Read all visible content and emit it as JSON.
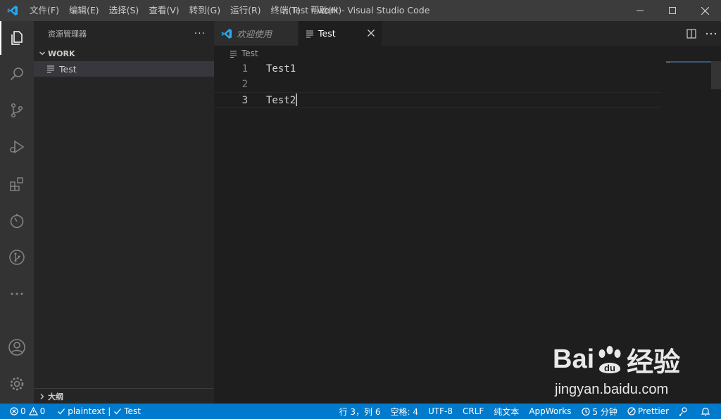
{
  "titlebar": {
    "menu": [
      "文件(F)",
      "编辑(E)",
      "选择(S)",
      "查看(V)",
      "转到(G)",
      "运行(R)",
      "终端(T)",
      "帮助(H)"
    ],
    "title": "Test - work - Visual Studio Code"
  },
  "sidebar": {
    "header": "资源管理器",
    "more": "···",
    "folder": "WORK",
    "file": "Test",
    "outline": "大纲"
  },
  "editor": {
    "tabs": [
      {
        "label": "欢迎使用",
        "active": false
      },
      {
        "label": "Test",
        "active": true
      }
    ],
    "breadcrumb": "Test",
    "lines": [
      {
        "num": "1",
        "text": "Test1"
      },
      {
        "num": "2",
        "text": ""
      },
      {
        "num": "3",
        "text": "Test2"
      }
    ]
  },
  "statusbar": {
    "errors": "0",
    "warnings": "0",
    "language": "plaintext",
    "separator": "|",
    "file": "Test",
    "position": "行 3，列 6",
    "spaces": "空格: 4",
    "encoding": "UTF-8",
    "eol": "CRLF",
    "mode": "纯文本",
    "appworks": "AppWorks",
    "time": "5 分钟",
    "prettier": "Prettier"
  },
  "watermark": {
    "logo_a": "Bai",
    "logo_b": "du",
    "logo_c": "经验",
    "url": "jingyan.baidu.com"
  },
  "colors": {
    "accent": "#007acc",
    "vscode_blue": "#23a9f2",
    "titlebar": "#3c3c3c",
    "activitybar": "#333333",
    "sidebar": "#252526",
    "editor": "#1e1e1e"
  }
}
